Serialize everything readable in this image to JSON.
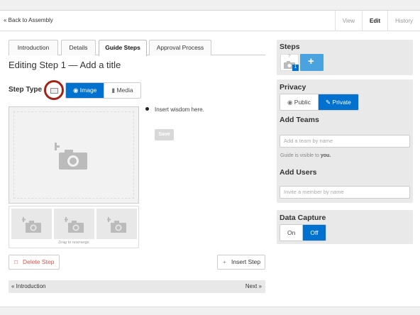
{
  "topbar": {
    "back_label": "« Back to Assembly",
    "nav": [
      "View",
      "Edit",
      "History"
    ],
    "active_nav": "Edit"
  },
  "tabs": [
    "Introduction",
    "Details",
    "Guide Steps",
    "Approval Process"
  ],
  "active_tab": "Guide Steps",
  "editor": {
    "title": "Editing Step 1 — Add a title",
    "step_type_label": "Step Type",
    "image_label": "Image",
    "media_label": "Media",
    "selected_type": "Image",
    "bullet_text": "Insert wisdom here.",
    "save_label": "Save",
    "drag_hint": "Drag to rearrange",
    "delete_label": "Delete Step",
    "insert_label": "Insert Step",
    "prev_label": "« Introduction",
    "next_label": "Next »"
  },
  "sidebar": {
    "steps_title": "Steps",
    "step_badge": "1",
    "step_question": "?",
    "privacy_title": "Privacy",
    "public_label": "Public",
    "private_label": "Private",
    "privacy_selected": "Private",
    "teams_title": "Add Teams",
    "teams_placeholder": "Add a team by name",
    "teams_hint_prefix": "Guide is visible to ",
    "teams_hint_bold": "you.",
    "users_title": "Add Users",
    "users_placeholder": "Invite a member by name",
    "data_capture_title": "Data Capture",
    "on_label": "On",
    "off_label": "Off",
    "data_capture_selected": "Off"
  },
  "colors": {
    "accent": "#0071ce",
    "highlight_ring": "#a22418",
    "delete": "#d9534f"
  }
}
